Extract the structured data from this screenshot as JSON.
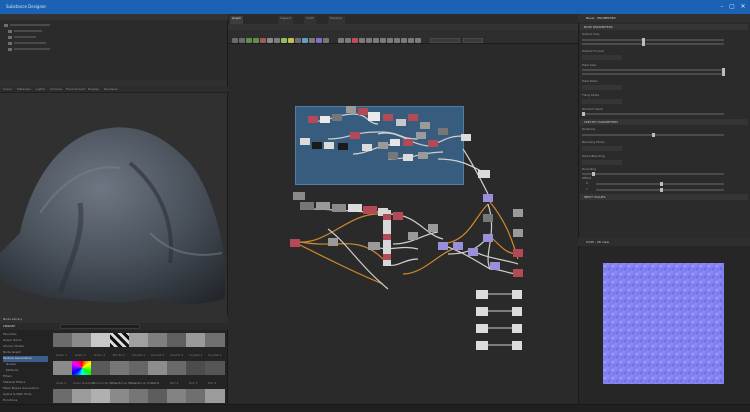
{
  "window": {
    "title": "Substance Designer"
  },
  "graph_tabs": [
    "Graph",
    "Inspect",
    "Cloth",
    "Explorer"
  ],
  "explorer": {
    "rows": 8
  },
  "view3d": {
    "menus": [
      "Scene",
      "Materials",
      "Lights",
      "Camera",
      "Environment",
      "Display",
      "Renderer"
    ]
  },
  "library": {
    "title": "LIBRARY",
    "panel_tab": "Node Library",
    "categories": [
      "Favorites",
      "Graph Items",
      "Atomic Nodes",
      "Node Graph",
      "Texture Generators",
      "Noises",
      "Patterns",
      "Filters",
      "Material Filters",
      "Mesh Based Generators",
      "Spline & Path Tools",
      "Functions"
    ],
    "selected_category": "Texture Generators",
    "thumb_row1_labels": [
      "Grain 1",
      "Grain 2",
      "Grain 3",
      "Bricks 1",
      "Clouds 1",
      "Clouds 2",
      "Clouds 3",
      "Crystal 1",
      "Crystal 2"
    ],
    "thumb_row2_labels": [
      "Cells 3",
      "Color Gradient",
      "Directional Noise 1",
      "Directional Noise 2",
      "Directional Noise 3",
      "Dirt 1",
      "Dirt 2",
      "Dirt 3",
      "Dirt 4"
    ]
  },
  "properties": {
    "title": "Bevel - PROPERTIES",
    "sections": [
      "BASE PARAMETERS",
      "SPECIFIC PARAMETERS",
      "INPUT VALUES"
    ],
    "params": [
      "Output Size",
      "Output Format",
      "Pixel Size",
      "Pixel Ratio",
      "Tiling Mode",
      "Random Seed",
      "Distance",
      "Blending Mode",
      "Alpha Blending",
      "Rounding",
      "Offset",
      "X",
      "Y"
    ]
  },
  "viewer2d": {
    "title": "Cloth - 2D view"
  },
  "colors": {
    "titlebar": "#1b62b4",
    "frame": "#375c7d",
    "normal_map": "#8080ff",
    "orange_link": "#d08a2a",
    "purple_node": "#9a8fd8",
    "red_node": "#b34a56"
  }
}
